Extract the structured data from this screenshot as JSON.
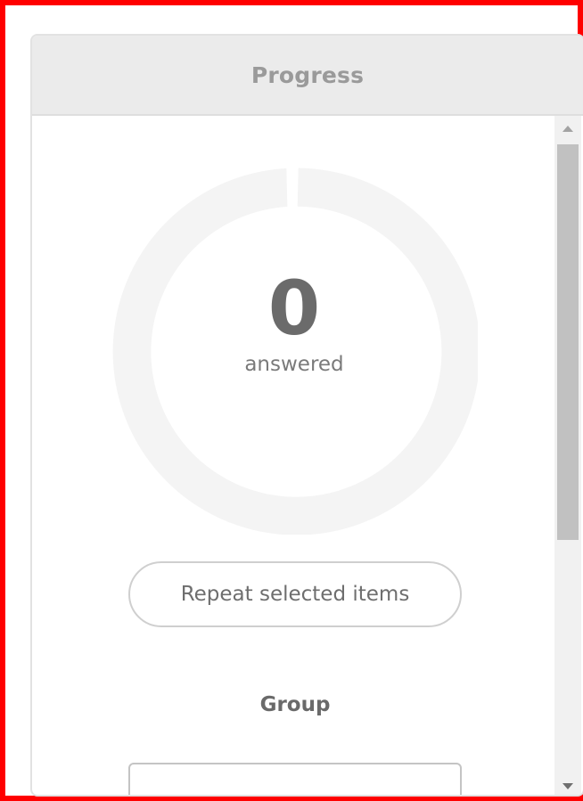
{
  "panel": {
    "title": "Progress"
  },
  "progress": {
    "answered_count": "0",
    "answered_label": "answered",
    "fraction_answered": 0
  },
  "actions": {
    "repeat_label": "Repeat selected items"
  },
  "group": {
    "heading": "Group",
    "selected_value": ""
  },
  "colors": {
    "frame_border": "#ff0000",
    "header_bg": "#ebebeb",
    "ring_track": "#f4f4f4",
    "scroll_thumb": "#c1c1c1"
  },
  "icons": {
    "scroll_up": "triangle-up-icon",
    "scroll_down": "triangle-down-icon"
  }
}
